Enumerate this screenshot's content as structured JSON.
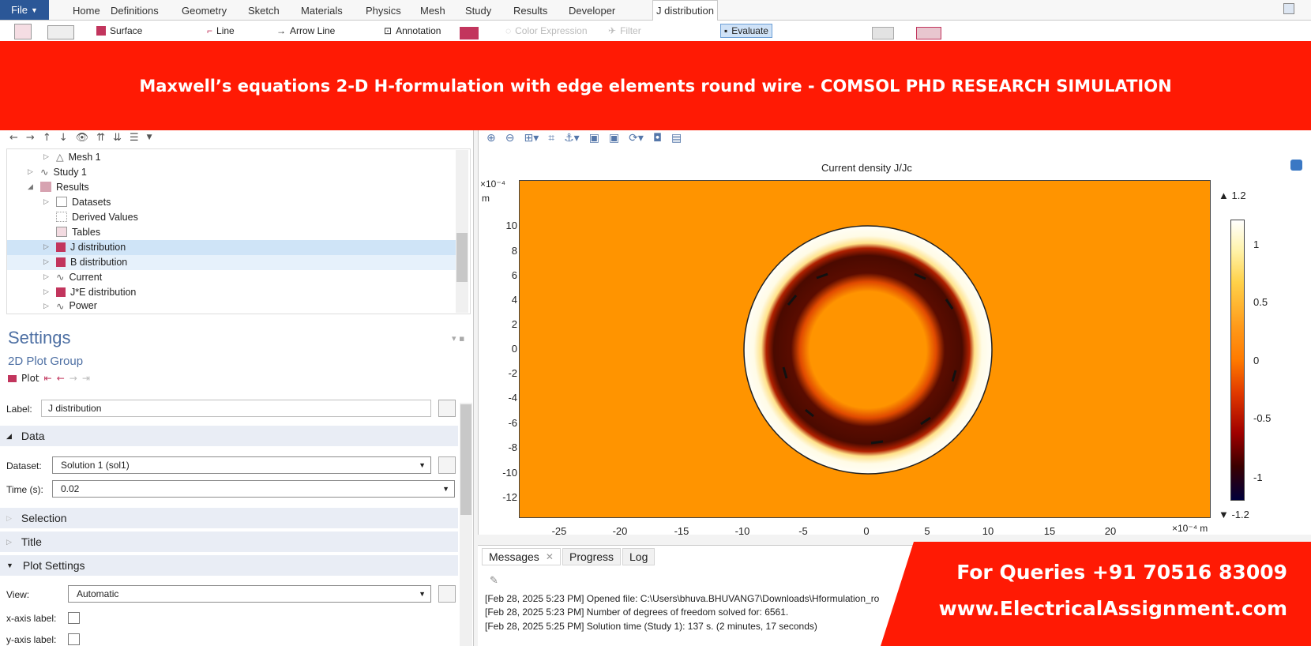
{
  "menu": {
    "file_label": "File",
    "tabs": [
      "Home",
      "Definitions",
      "Geometry",
      "Sketch",
      "Materials",
      "Physics",
      "Mesh",
      "Study",
      "Results",
      "Developer",
      "J distribution"
    ]
  },
  "ribbon": {
    "surface": "Surface",
    "line": "Line",
    "arrow_line": "Arrow Line",
    "annotation": "Annotation",
    "color_expression": "Color Expression",
    "filter": "Filter",
    "evaluate": "Evaluate"
  },
  "banner": "Maxwell’s equations 2-D H-formulation with edge elements round wire - COMSOL PHD RESEARCH SIMULATION",
  "tree": {
    "items": [
      "Mesh 1",
      "Study 1",
      "Results",
      "Datasets",
      "Derived Values",
      "Tables",
      "J distribution",
      "B distribution",
      "Current",
      "J*E distribution",
      "Power"
    ]
  },
  "settings": {
    "heading": "Settings",
    "subheading": "2D Plot Group",
    "plot_button": "Plot",
    "label_caption": "Label:",
    "label_value": "J distribution",
    "data_section": "Data",
    "dataset_caption": "Dataset:",
    "dataset_value": "Solution 1 (sol1)",
    "time_caption": "Time (s):",
    "time_value": "0.02",
    "selection_section": "Selection",
    "title_section": "Title",
    "plot_settings_section": "Plot Settings",
    "view_caption": "View:",
    "view_value": "Automatic",
    "xaxis_caption": "x-axis label:",
    "yaxis_caption": "y-axis label:"
  },
  "plot": {
    "title": "Current density J/Jc",
    "y_exponent": "×10⁻⁴",
    "y_unit": "m",
    "x_exponent": "×10⁻⁴",
    "x_unit": "m",
    "y_ticks": [
      "10",
      "8",
      "6",
      "4",
      "2",
      "0",
      "-2",
      "-4",
      "-6",
      "-8",
      "-10",
      "-12"
    ],
    "x_ticks": [
      "-25",
      "-20",
      "-15",
      "-10",
      "-5",
      "0",
      "5",
      "10",
      "15",
      "20"
    ],
    "colorbar_max": "▲ 1.2",
    "colorbar_min": "▼ -1.2",
    "colorbar_ticks": [
      "1",
      "0.5",
      "0",
      "-0.5",
      "-1"
    ],
    "colors": {
      "background": "#ff9400",
      "ring_dark": "#4a0a00",
      "edge_light": "#fffbe6"
    }
  },
  "messages": {
    "tabs": [
      "Messages",
      "Progress",
      "Log"
    ],
    "lines": [
      "[Feb 28, 2025 5:23 PM] Opened file: C:\\Users\\bhuva.BHUVANG7\\Downloads\\Hformulation_ro",
      "[Feb 28, 2025 5:23 PM] Number of degrees of freedom solved for: 6561.",
      "[Feb 28, 2025 5:25 PM] Solution time (Study 1): 137 s. (2 minutes, 17 seconds)"
    ]
  },
  "promo": {
    "phone": "For Queries +91 70516 83009",
    "site": "www.ElectricalAssignment.com"
  }
}
